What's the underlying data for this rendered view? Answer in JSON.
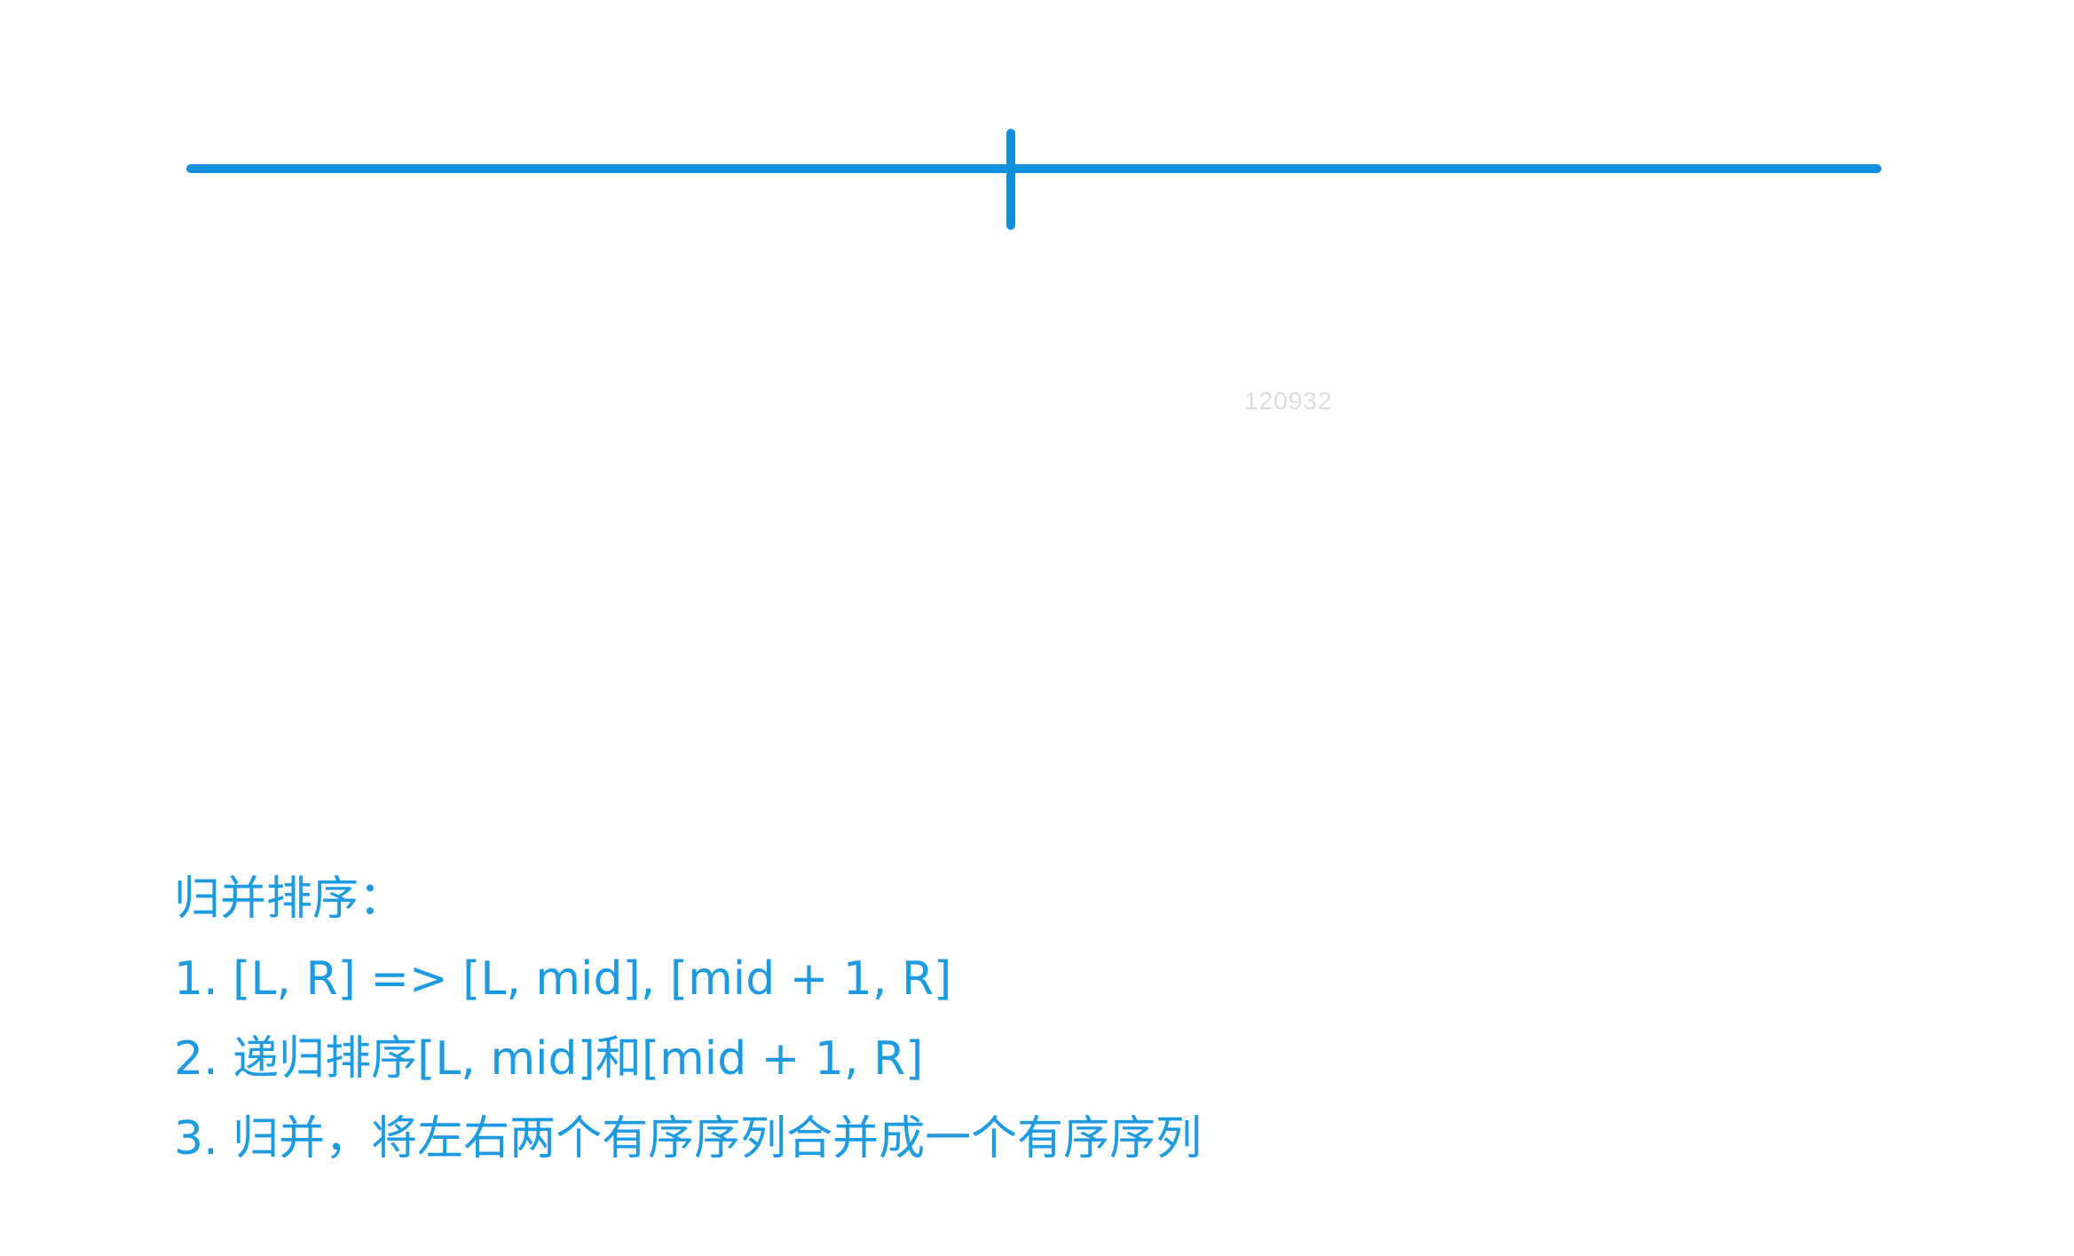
{
  "diagram": {
    "color": "#0f8fde",
    "segment": {
      "label_left": "",
      "label_right": ""
    }
  },
  "watermark": "120932",
  "notes": {
    "title": "归并排序：",
    "steps": [
      "1. [L, R] => [L, mid], [mid + 1, R]",
      "2. 递归排序[L, mid]和[mid + 1, R]",
      "3. 归并，将左右两个有序序列合并成一个有序序列"
    ],
    "text_color": "#1e9be0"
  }
}
